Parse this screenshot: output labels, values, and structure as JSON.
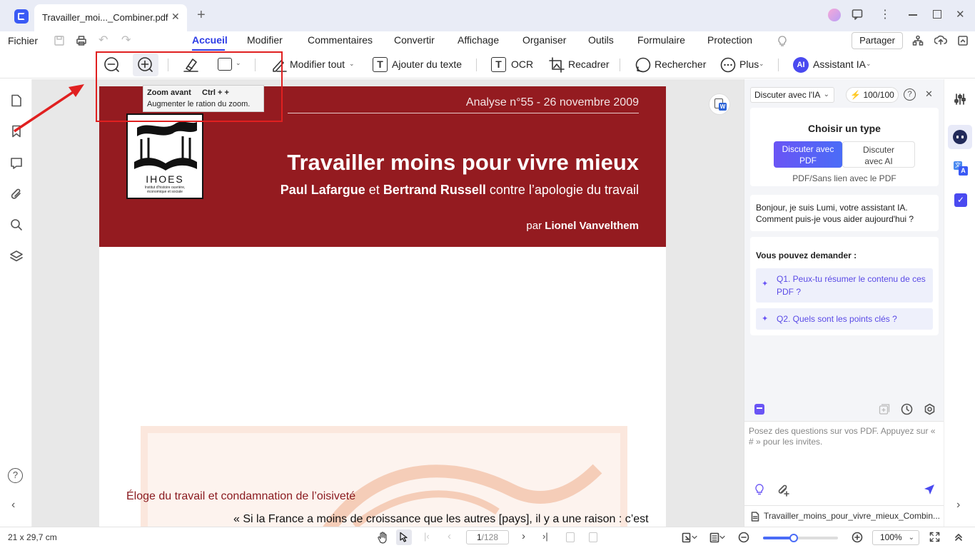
{
  "titlebar": {
    "tab_title": "Travailler_moi..._Combiner.pdf"
  },
  "menubar": {
    "file": "Fichier",
    "items": [
      "Accueil",
      "Modifier",
      "Commentaires",
      "Convertir",
      "Affichage",
      "Organiser",
      "Outils",
      "Formulaire",
      "Protection"
    ],
    "share": "Partager"
  },
  "toolbar": {
    "edit_all": "Modifier tout",
    "add_text": "Ajouter du texte",
    "ocr": "OCR",
    "crop": "Recadrer",
    "search": "Rechercher",
    "more": "Plus",
    "ai_badge": "AI",
    "ai_assistant": "Assistant IA"
  },
  "tooltip": {
    "title": "Zoom avant",
    "shortcut": "Ctrl + +",
    "desc": "Augmenter le ration du zoom."
  },
  "document": {
    "issue": "Analyse n°55 - 26 novembre 2009",
    "logo": "IHOES",
    "logo_sub": "Institut d'histoire ouvrière, économique et sociale",
    "title": "Travailler moins pour vivre mieux",
    "subtitle_a": "Paul Lafargue",
    "subtitle_et": " et ",
    "subtitle_b": "Bertrand Russell",
    "subtitle_rest": " contre l’apologie du travail",
    "by": "par ",
    "author": "Lionel Vanvelthem",
    "section": "Éloge du travail et condamnation de l’oisiveté",
    "quote": "« Si la France a moins de croissance que les autres [pays], il y a une raison : c’est"
  },
  "ai_panel": {
    "mode_select": "Discuter avec l'IA",
    "credits": "100/100",
    "choose_type": "Choisir un type",
    "type_pdf": "Discuter avec PDF",
    "type_ai": "Discuter avec AI",
    "type_note": "PDF/Sans lien avec le PDF",
    "greeting": "Bonjour, je suis Lumi, votre assistant IA. Comment puis-je vous aider aujourd'hui ?",
    "ask_heading": "Vous pouvez demander :",
    "q1": "Q1. Peux-tu résumer le contenu de ces PDF ?",
    "q2": "Q2. Quels sont les points clés ?",
    "input_placeholder": "Posez des questions sur vos PDF. Appuyez sur « # » pour les invites.",
    "file_name": "Travailler_moins_pour_vivre_mieux_Combin..."
  },
  "status": {
    "page_size": "21 x 29,7 cm",
    "page_current": "1",
    "page_total": "/128",
    "zoom": "100%"
  },
  "colors": {
    "accent": "#4a4af0",
    "banner": "#941b20",
    "annotation": "#e02020"
  }
}
